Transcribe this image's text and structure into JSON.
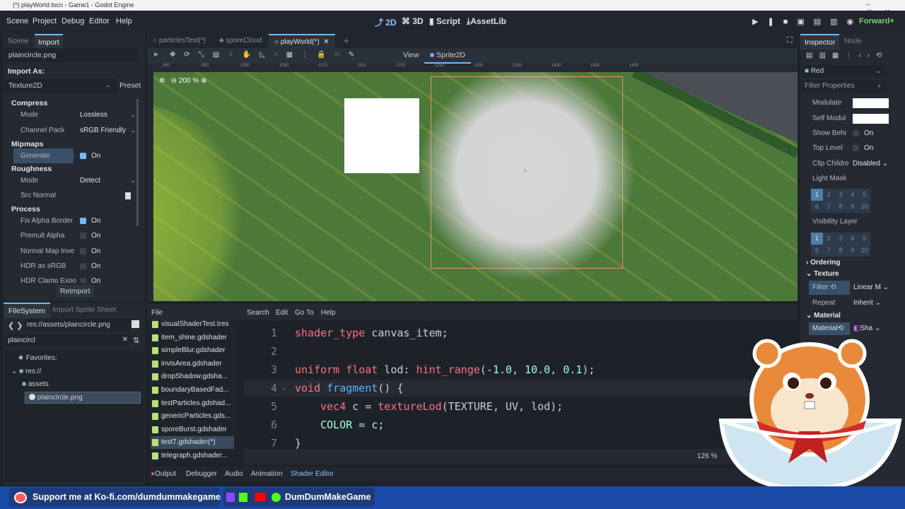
{
  "window": {
    "title": "(*) playWorld.tscn - Game1 - Godot Engine"
  },
  "menu": [
    "Scene",
    "Project",
    "Debug",
    "Editor",
    "Help"
  ],
  "workspaces": [
    "2D",
    "3D",
    "Script",
    "AssetLib"
  ],
  "renderer": "Forward+",
  "left_dock": {
    "tabs": [
      "Scene",
      "Import"
    ],
    "file": "plaincircle.png",
    "import_as_label": "Import As:",
    "import_as": "Texture2D",
    "preset": "Preset",
    "sections": [
      {
        "title": "Compress",
        "rows": [
          {
            "label": "Mode",
            "value": "Lossless",
            "type": "select"
          },
          {
            "label": "Channel Pack",
            "value": "sRGB Friendly",
            "type": "select"
          }
        ]
      },
      {
        "title": "Mipmaps",
        "rows": [
          {
            "label": "Generate",
            "value": "On",
            "type": "check",
            "checked": true
          }
        ]
      },
      {
        "title": "Roughness",
        "rows": [
          {
            "label": "Mode",
            "value": "Detect",
            "type": "select"
          },
          {
            "label": "Src Normal",
            "value": "",
            "type": "file"
          }
        ]
      },
      {
        "title": "Process",
        "rows": [
          {
            "label": "Fix Alpha Border",
            "value": "On",
            "type": "check",
            "checked": true
          },
          {
            "label": "Premult Alpha",
            "value": "On",
            "type": "check",
            "checked": false
          },
          {
            "label": "Normal Map Inve",
            "value": "On",
            "type": "check",
            "checked": false
          },
          {
            "label": "HDR as sRGB",
            "value": "On",
            "type": "check",
            "checked": false
          },
          {
            "label": "HDR Clamp Expo",
            "value": "On",
            "type": "check",
            "checked": false
          }
        ]
      }
    ],
    "reimport": "Reimport"
  },
  "filesystem": {
    "tabs": [
      "FileSystem",
      "Import Sprite Sheet"
    ],
    "path": "res://assets/plaincircle.png",
    "filter": "plaincircl",
    "favorites": "Favorites:",
    "tree": [
      "res://",
      "assets",
      "plaincircle.png"
    ]
  },
  "scene_tabs": [
    "particlesTest(*)",
    "sporeCloud",
    "playWorld(*)"
  ],
  "toolbar": {
    "view": "View",
    "sprite": "Sprite2D",
    "zoom": "200 %"
  },
  "ruler": [
    "900",
    "950",
    "1000",
    "1050",
    "1100",
    "1150",
    "1200",
    "1250",
    "1300",
    "1350",
    "1400",
    "1450",
    "1500"
  ],
  "shader_editor": {
    "menu": [
      "File",
      "Search",
      "Edit",
      "Go To",
      "Help"
    ],
    "files": [
      "visualShaderTest.tres",
      "item_shine.gdshader",
      "simpleBlur.gdshader",
      "invisArea.gdshader",
      "dropShadow.gdsha...",
      "boundaryBasedFad...",
      "testParticles.gdshad...",
      "genericParticles.gds...",
      "sporeBurst.gdshader",
      "test7.gdshader(*)",
      "telegraph.gdshader..."
    ],
    "line_numbers": [
      "1",
      "2",
      "3",
      "4",
      "5",
      "6",
      "7"
    ],
    "code": {
      "l1a": "shader_type",
      "l1b": " canvas_item;",
      "l3a": "uniform float",
      "l3b": " lod: ",
      "l3c": "hint_range",
      "l3d": "(",
      "l3e": "-1.0",
      "l3f": ", ",
      "l3g": "10.0",
      "l3h": ", ",
      "l3i": "0.1",
      "l3j": ");",
      "l4a": "void",
      "l4b": " ",
      "l4c": "fragment",
      "l4d": "() {",
      "l5a": "    vec4",
      "l5b": " c = ",
      "l5c": "textureLod",
      "l5d": "(TEXTURE, UV, lod);",
      "l6": "    COLOR = c;",
      "l7": "}"
    },
    "zoom": "126 %"
  },
  "bottom_tabs": [
    "Output",
    "Debugger",
    "Audio",
    "Animation",
    "Shader Editor"
  ],
  "inspector": {
    "tabs": [
      "Inspector",
      "Node"
    ],
    "object": "Red",
    "filter_placeholder": "Filter Properties",
    "modulate": "Modulate",
    "self_modulate": "Self Modul",
    "show_behind": "Show Behi",
    "top_level": "Top Level",
    "clip_children": "Clip Childre",
    "clip_value": "Disabled",
    "on": "On",
    "light_mask": "Light Mask",
    "visibility_layer": "Visibility Layer",
    "layers": [
      "1",
      "2",
      "3",
      "4",
      "5",
      "6",
      "7",
      "8",
      "9",
      "10"
    ],
    "ordering": "Ordering",
    "texture": "Texture",
    "filter": "Filter",
    "filter_value": "Linear M",
    "repeat": "Repeat",
    "repeat_value": "Inherit",
    "material_section": "Material",
    "material": "Material",
    "material_value": "Sha"
  },
  "banner": {
    "kofi": "Support me at Ko-fi.com/dumdummakegame",
    "channel": "DumDumMakeGame"
  }
}
